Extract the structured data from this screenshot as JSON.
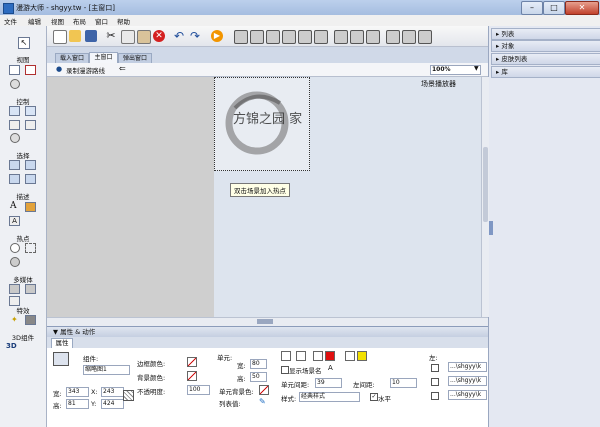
{
  "window": {
    "title": "漫游大师 - shgyy.tw - [主窗口]"
  },
  "menu": [
    "文件",
    "编辑",
    "视图",
    "布局",
    "窗口",
    "帮助"
  ],
  "left_toolbox": {
    "sections": [
      {
        "label": "视图"
      },
      {
        "label": "控制"
      },
      {
        "label": "选择"
      },
      {
        "label": "描述"
      },
      {
        "label": "热点"
      },
      {
        "label": "多媒体"
      },
      {
        "label": "特效"
      },
      {
        "label": "3D组件"
      }
    ]
  },
  "right_panel": {
    "items": [
      "列表",
      "对象",
      "皮肤列表",
      "库"
    ]
  },
  "tabs": [
    "载入窗口",
    "主窗口",
    "弹出窗口"
  ],
  "subbar": {
    "record_label": "录制漫游路线",
    "zoom_value": "100%"
  },
  "stage": {
    "label": "场景播放器",
    "tooltip": "双击场景加入热点",
    "logo_text": "方锦之园 家"
  },
  "properties": {
    "header": "属性 & 动作",
    "tab": "属性",
    "component_label": "组件:",
    "component_value": "缩略图1",
    "width_label": "宽:",
    "width_value": "343",
    "height_label": "高:",
    "height_value": "81",
    "x_label": "X:",
    "x_value": "243",
    "y_label": "Y:",
    "y_value": "424",
    "border_color_label": "边框颜色:",
    "bg_color_label": "背景颜色:",
    "opacity_label": "不透明度:",
    "opacity_value": "100",
    "cell_label": "单元:",
    "cell_width_label": "宽:",
    "cell_width_value": "80",
    "cell_height_label": "高:",
    "cell_height_value": "50",
    "cell_bg_label": "单元背景色:",
    "list_value_label": "列表值:",
    "show_scene_name_label": "显示场景名",
    "cell_spacing_label": "单元间距:",
    "cell_spacing_value": "39",
    "left_spacing_label": "左间距:",
    "left_spacing_value": "10",
    "style_label": "样式:",
    "style_value": "经典样式",
    "horizontal_label": "水平",
    "left_label": "左:",
    "path_values": [
      "...\\shgyy\\k",
      "...\\shgyy\\k",
      "...\\shgyy\\k"
    ]
  },
  "colors": {
    "accent": "#2d6cc0",
    "stage_bg": "#dde4ee",
    "canvas_bg": "#cfcfcf",
    "red_swatch": "#e01010",
    "yellow_swatch": "#f2e000"
  }
}
